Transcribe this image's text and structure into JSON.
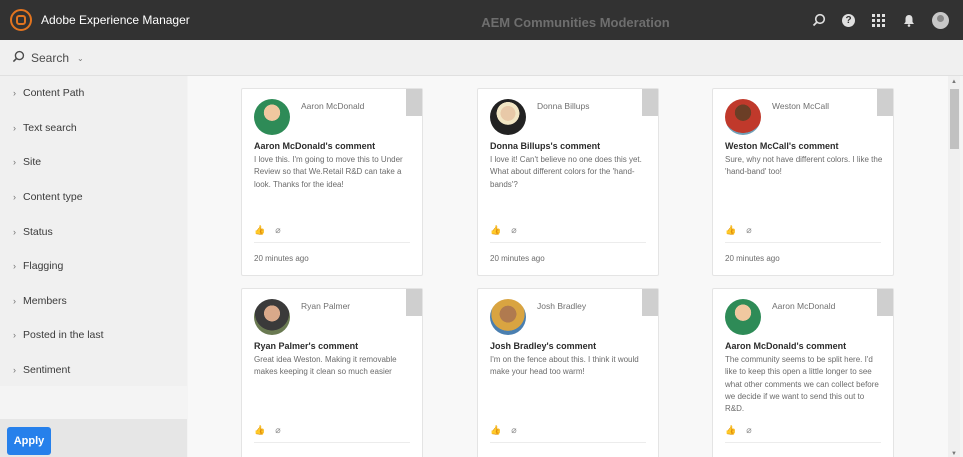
{
  "header": {
    "app_title": "Adobe Experience Manager",
    "icons": [
      "search-icon",
      "help-icon",
      "apps-grid-icon",
      "bell-icon",
      "user-avatar-icon"
    ]
  },
  "search": {
    "label": "Search"
  },
  "page": {
    "title": "AEM Communities Moderation"
  },
  "sidebar": {
    "facets": [
      {
        "label": "Content Path"
      },
      {
        "label": "Text search"
      },
      {
        "label": "Site"
      },
      {
        "label": "Content type"
      },
      {
        "label": "Status"
      },
      {
        "label": "Flagging"
      },
      {
        "label": "Members"
      },
      {
        "label": "Posted in the last"
      },
      {
        "label": "Sentiment"
      }
    ],
    "apply_label": "Apply"
  },
  "cards": [
    {
      "author": "Aaron McDonald",
      "title": "Aaron McDonald's comment",
      "text": "I love this. I'm going to move this to Under Review so that We.Retail R&D can take a look. Thanks for the idea!",
      "time": "20 minutes ago",
      "avatar_color": "#2e8b57"
    },
    {
      "author": "Donna Billups",
      "title": "Donna Billups's comment",
      "text": "I love it! Can't believe no one does this yet. What about different colors for the 'hand-bands'?",
      "time": "20 minutes ago",
      "avatar_color": "#b07a3a"
    },
    {
      "author": "Weston McCall",
      "title": "Weston McCall's comment",
      "text": "Sure, why not have different colors. I like the 'hand-band' too!",
      "time": "20 minutes ago",
      "avatar_color": "#c0392b"
    },
    {
      "author": "Ryan Palmer",
      "title": "Ryan Palmer's comment",
      "text": "Great idea Weston. Making it removable makes keeping it clean so much easier",
      "time": "",
      "avatar_color": "#4a5a3a"
    },
    {
      "author": "Josh Bradley",
      "title": "Josh Bradley's comment",
      "text": "I'm on the fence about this. I think it would make your head too warm!",
      "time": "",
      "avatar_color": "#d9a441"
    },
    {
      "author": "Aaron McDonald",
      "title": "Aaron McDonald's comment",
      "text": "The community seems to be split here. I'd like to keep this open a little longer to see what other comments we can collect before we decide if we want to send this out to R&D.",
      "time": "",
      "avatar_color": "#2e8b57"
    }
  ]
}
